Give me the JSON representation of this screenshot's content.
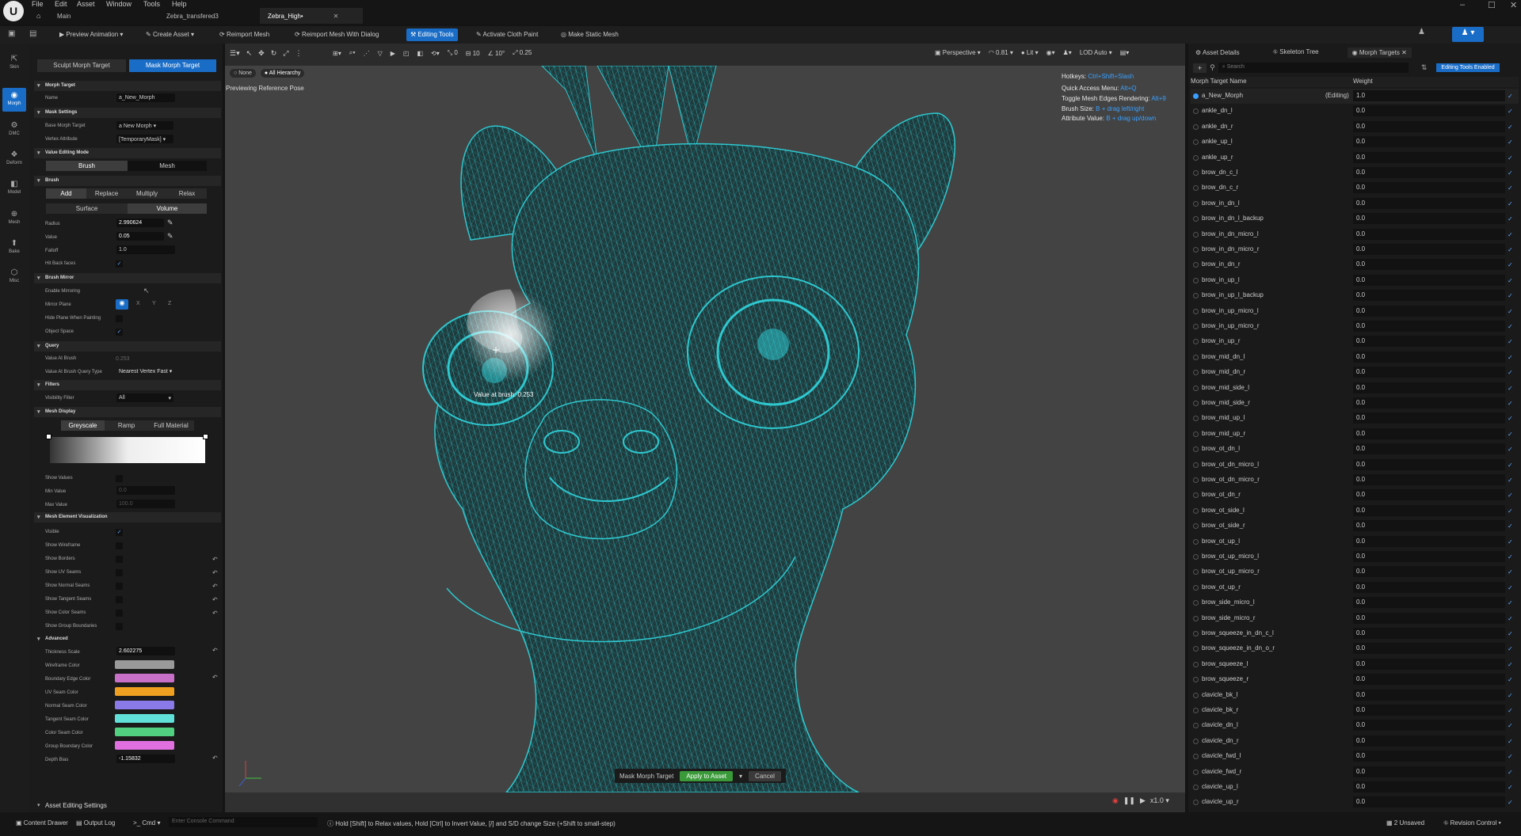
{
  "menu": {
    "file": "File",
    "edit": "Edit",
    "asset": "Asset",
    "window": "Window",
    "tools": "Tools",
    "help": "Help"
  },
  "tabs": {
    "main": "Main",
    "t2": "Zebra_transfered3",
    "t3": "Zebra_High•"
  },
  "toolbar": {
    "preview_animation": "Preview Animation",
    "create_asset": "Create Asset",
    "reimport_mesh": "Reimport Mesh",
    "reimport_dialog": "Reimport Mesh With Dialog",
    "editing_tools": "Editing Tools",
    "activate_cloth": "Activate Cloth Paint",
    "make_static": "Make Static Mesh"
  },
  "leftstrip": [
    {
      "label": "Skin"
    },
    {
      "label": "Morph"
    },
    {
      "label": "DMC"
    },
    {
      "label": "Deform"
    },
    {
      "label": "Model"
    },
    {
      "label": "Mesh"
    },
    {
      "label": "Bake"
    },
    {
      "label": "Misc"
    }
  ],
  "mode_tabs": {
    "sculpt": "Sculpt Morph Target",
    "mask": "Mask Morph Target"
  },
  "sections": {
    "morph_target": "Morph Target",
    "mask_settings": "Mask Settings",
    "value_editing": "Value Editing Mode",
    "brush": "Brush",
    "brush_mirror": "Brush Mirror",
    "query": "Query",
    "filters": "Filters",
    "mesh_display": "Mesh Display",
    "mesh_element": "Mesh Element Visualization",
    "advanced": "Advanced",
    "asset_editing": "Asset Editing Settings"
  },
  "props": {
    "name_lbl": "Name",
    "name_val": "a_New_Morph",
    "base_lbl": "Base Morph Target",
    "base_val": "a New Morph",
    "vertex_lbl": "Vertex Attribute",
    "vertex_val": "[TemporaryMask]",
    "seg_brush": "Brush",
    "seg_mesh": "Mesh",
    "add": "Add",
    "replace": "Replace",
    "multiply": "Multiply",
    "relax": "Relax",
    "surface": "Surface",
    "volume": "Volume",
    "radius_lbl": "Radius",
    "radius_val": "2.990624",
    "value_lbl": "Value",
    "value_val": "0.05",
    "falloff_lbl": "Falloff",
    "falloff_val": "1.0",
    "hitback_lbl": "Hit Back faces",
    "enable_mirror_lbl": "Enable Mirroring",
    "mirror_plane_lbl": "Mirror Plane",
    "x": "X",
    "y": "Y",
    "z": "Z",
    "hide_plane_lbl": "Hide Plane When Painting",
    "object_space_lbl": "Object Space",
    "value_at_brush_lbl": "Value At Brush",
    "value_at_brush_val": "0.253",
    "query_type_lbl": "Value At Brush Query Type",
    "query_type_val": "Nearest Vertex Fast",
    "vis_filter_lbl": "Visibility Filter",
    "vis_filter_val": "All",
    "greyscale": "Greyscale",
    "ramp": "Ramp",
    "full_material": "Full Material",
    "show_values_lbl": "Show Values",
    "min_lbl": "Min Value",
    "min_val": "0.0",
    "max_lbl": "Max Value",
    "max_val": "100.0",
    "visible_lbl": "Visible",
    "wire_lbl": "Show Wireframe",
    "borders_lbl": "Show Borders",
    "uv_lbl": "Show UV Seams",
    "normal_lbl": "Show Normal Seams",
    "tangent_lbl": "Show Tangent Seams",
    "color_lbl": "Show Color Seams",
    "group_lbl": "Show Group Boundaries",
    "thick_lbl": "Thickness Scale",
    "thick_val": "2.602275",
    "wire_color_lbl": "Wireframe Color",
    "boundary_color_lbl": "Boundary Edge Color",
    "uvseam_color_lbl": "UV Seam Color",
    "normal_color_lbl": "Normal Seam Color",
    "tangent_color_lbl": "Tangent Seam Color",
    "color_seam_lbl": "Color Seam Color",
    "group_color_lbl": "Group Boundary Color",
    "depth_lbl": "Depth Bias",
    "depth_val": "-1.15832"
  },
  "colors": {
    "wire": "#9a9a9a",
    "boundary": "#c870c8",
    "uvseam": "#f0a020",
    "normal": "#8a7ae8",
    "tangent": "#60e0d8",
    "colorseam": "#50d080",
    "group": "#e070e0",
    "mesh": "#2ec8cf"
  },
  "viewport": {
    "none": "None",
    "all_hierarchy": "All Hierarchy",
    "previewing": "Previewing Reference Pose",
    "perspective": "Perspective",
    "fov": "0.81",
    "lit": "Lit",
    "lod": "LOD Auto",
    "snap1": "0",
    "snap2": "10",
    "snap3": "10°",
    "snap4": "0.25",
    "hk_hotkeys": "Hotkeys:",
    "hk_hotkeys_v": "Ctrl+Shift+Slash",
    "hk_quick": "Quick Access Menu:",
    "hk_quick_v": "Alt+Q",
    "hk_toggle": "Toggle Mesh Edges Rendering:",
    "hk_toggle_v": "Alt+9",
    "hk_brush": "Brush Size:",
    "hk_brush_v": "B + drag left/right",
    "hk_attr": "Attribute Value:",
    "hk_attr_v": "B + drag up/down",
    "brush_readout": "Value at brush: 0.253",
    "accept_title": "Mask Morph Target",
    "apply": "Apply to Asset",
    "cancel": "Cancel",
    "speed": "x1.0"
  },
  "right": {
    "tab_details": "Asset Details",
    "tab_skeleton": "Skeleton Tree",
    "tab_morph": "Morph Targets",
    "search_placeholder": "Search",
    "editing_enabled": "Editing Tools Enabled",
    "col_name": "Morph Target Name",
    "col_weight": "Weight"
  },
  "morphs": [
    {
      "name": "a_New_Morph",
      "editing": "(Editing)",
      "weight": "1.0"
    },
    {
      "name": "ankle_dn_l",
      "weight": "0.0"
    },
    {
      "name": "ankle_dn_r",
      "weight": "0.0"
    },
    {
      "name": "ankle_up_l",
      "weight": "0.0"
    },
    {
      "name": "ankle_up_r",
      "weight": "0.0"
    },
    {
      "name": "brow_dn_c_l",
      "weight": "0.0"
    },
    {
      "name": "brow_dn_c_r",
      "weight": "0.0"
    },
    {
      "name": "brow_in_dn_l",
      "weight": "0.0"
    },
    {
      "name": "brow_in_dn_l_backup",
      "weight": "0.0"
    },
    {
      "name": "brow_in_dn_micro_l",
      "weight": "0.0"
    },
    {
      "name": "brow_in_dn_micro_r",
      "weight": "0.0"
    },
    {
      "name": "brow_in_dn_r",
      "weight": "0.0"
    },
    {
      "name": "brow_in_up_l",
      "weight": "0.0"
    },
    {
      "name": "brow_in_up_l_backup",
      "weight": "0.0"
    },
    {
      "name": "brow_in_up_micro_l",
      "weight": "0.0"
    },
    {
      "name": "brow_in_up_micro_r",
      "weight": "0.0"
    },
    {
      "name": "brow_in_up_r",
      "weight": "0.0"
    },
    {
      "name": "brow_mid_dn_l",
      "weight": "0.0"
    },
    {
      "name": "brow_mid_dn_r",
      "weight": "0.0"
    },
    {
      "name": "brow_mid_side_l",
      "weight": "0.0"
    },
    {
      "name": "brow_mid_side_r",
      "weight": "0.0"
    },
    {
      "name": "brow_mid_up_l",
      "weight": "0.0"
    },
    {
      "name": "brow_mid_up_r",
      "weight": "0.0"
    },
    {
      "name": "brow_ot_dn_l",
      "weight": "0.0"
    },
    {
      "name": "brow_ot_dn_micro_l",
      "weight": "0.0"
    },
    {
      "name": "brow_ot_dn_micro_r",
      "weight": "0.0"
    },
    {
      "name": "brow_ot_dn_r",
      "weight": "0.0"
    },
    {
      "name": "brow_ot_side_l",
      "weight": "0.0"
    },
    {
      "name": "brow_ot_side_r",
      "weight": "0.0"
    },
    {
      "name": "brow_ot_up_l",
      "weight": "0.0"
    },
    {
      "name": "brow_ot_up_micro_l",
      "weight": "0.0"
    },
    {
      "name": "brow_ot_up_micro_r",
      "weight": "0.0"
    },
    {
      "name": "brow_ot_up_r",
      "weight": "0.0"
    },
    {
      "name": "brow_side_micro_l",
      "weight": "0.0"
    },
    {
      "name": "brow_side_micro_r",
      "weight": "0.0"
    },
    {
      "name": "brow_squeeze_in_dn_c_l",
      "weight": "0.0"
    },
    {
      "name": "brow_squeeze_in_dn_o_r",
      "weight": "0.0"
    },
    {
      "name": "brow_squeeze_l",
      "weight": "0.0"
    },
    {
      "name": "brow_squeeze_r",
      "weight": "0.0"
    },
    {
      "name": "clavicle_bk_l",
      "weight": "0.0"
    },
    {
      "name": "clavicle_bk_r",
      "weight": "0.0"
    },
    {
      "name": "clavicle_dn_l",
      "weight": "0.0"
    },
    {
      "name": "clavicle_dn_r",
      "weight": "0.0"
    },
    {
      "name": "clavicle_fwd_l",
      "weight": "0.0"
    },
    {
      "name": "clavicle_fwd_r",
      "weight": "0.0"
    },
    {
      "name": "clavicle_up_l",
      "weight": "0.0"
    },
    {
      "name": "clavicle_up_r",
      "weight": "0.0"
    }
  ],
  "status": {
    "content_drawer": "Content Drawer",
    "output_log": "Output Log",
    "cmd": "Cmd",
    "console_placeholder": "Enter Console Command",
    "hint": "Hold [Shift] to Relax values, Hold [Ctrl] to Invert Value, [/] and S/D change Size (+Shift to small-step)",
    "unsaved": "2 Unsaved",
    "revision": "Revision Control"
  }
}
